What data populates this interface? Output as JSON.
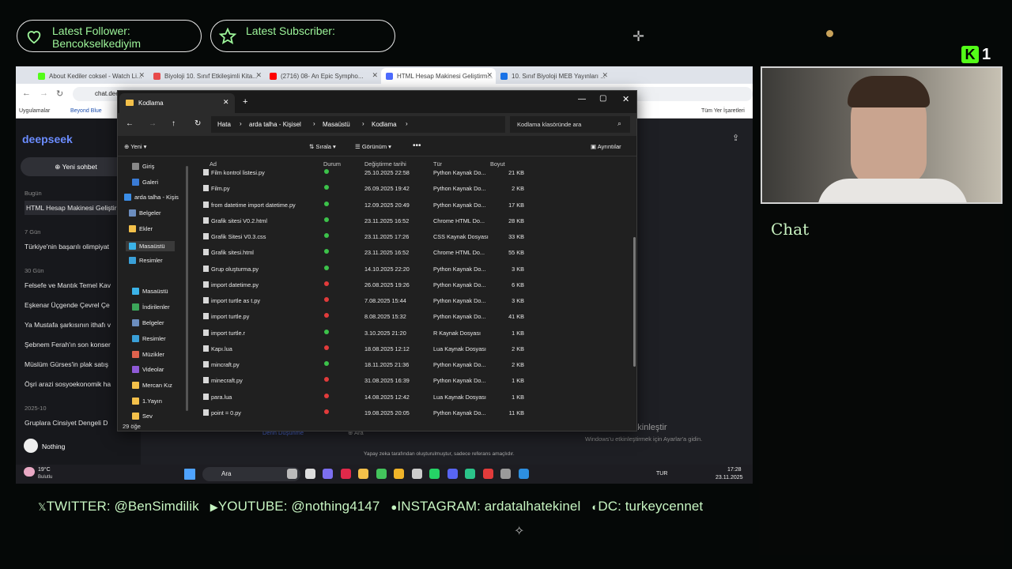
{
  "overlay": {
    "follower": {
      "label": "Latest Follower:",
      "name": "Bencokselkediyim"
    },
    "subscriber": {
      "label": "Latest Subscriber:"
    },
    "brand": "1",
    "chat_title": "Chat",
    "socials": [
      {
        "icon": "twitter-icon",
        "text": "TWITTER: @BenSimdilik"
      },
      {
        "icon": "youtube-icon",
        "text": "YOUTUBE: @nothing4147"
      },
      {
        "icon": "instagram-icon",
        "text": "INSTAGRAM: ardatalhatekinel"
      },
      {
        "icon": "discord-icon",
        "text": "DC: turkeycennet"
      }
    ]
  },
  "browser": {
    "tabs": [
      {
        "label": "About Kediler coksel - Watch Li...",
        "color": "#53fc18"
      },
      {
        "label": "Biyoloji 10. Sınıf Etkileşimli Kita...",
        "color": "#e94b4b"
      },
      {
        "label": "(2716) 08- An Epic Sympho...",
        "color": "#ff0000"
      },
      {
        "label": "HTML Hesap Makinesi Geliştirm...",
        "color": "#4d6bfe"
      },
      {
        "label": "10. Sınıf Biyoloji MEB Yayınları ...",
        "color": "#1a73e8"
      }
    ],
    "address": "chat.dee",
    "bookmarks": [
      "Uygulamalar",
      "Beyond Blue"
    ],
    "bookmarks_right": "Tüm Yer İşaretleri"
  },
  "deepseek": {
    "logo": "deepseek",
    "new_chat": "Yeni sohbet",
    "groups": [
      {
        "label": "Bugün",
        "items": [
          "HTML Hesap Makinesi Geliştir"
        ]
      },
      {
        "label": "7 Gün",
        "items": [
          "Türkiye'nin başarılı olimpiyat"
        ]
      },
      {
        "label": "30 Gün",
        "items": [
          "Felsefe ve Mantık Temel Kav",
          "Eşkenar Üçgende Çevrel Çe",
          "Ya Mustafa şarkısının ithafı v",
          "Şebnem Ferah'ın son konser",
          "Müslüm Gürses'in plak satış",
          "Öşri arazi sosyoekonomik ha"
        ]
      },
      {
        "label": "2025-10",
        "items": [
          "Gruplara Cinsiyet Dengeli D"
        ]
      }
    ],
    "user": "Nothing",
    "deep_think": "Derin Düşünme",
    "search": "Ara",
    "footer": "Yapay zeka tarafından oluşturulmuştur, sadece referans amaçlıdır."
  },
  "explorer": {
    "tab_title": "Kodlama",
    "breadcrumb": [
      "Hata",
      "arda talha - Kişisel",
      "Masaüstü",
      "Kodlama"
    ],
    "search_placeholder": "Kodlama klasöründe ara",
    "toolbar": {
      "new": "Yeni",
      "sort": "Sırala",
      "view": "Görünüm",
      "details": "Ayrıntılar"
    },
    "tree": [
      "Giriş",
      "Galeri",
      "arda talha - Kişis",
      "Belgeler",
      "Ekler",
      "Masaüstü",
      "Resimler",
      "Masaüstü",
      "İndirilenler",
      "Belgeler",
      "Resimler",
      "Müzikler",
      "Videolar",
      "Mercan Kız",
      "1.Yayın",
      "Sev"
    ],
    "columns": [
      "Ad",
      "Durum",
      "Değiştirme tarihi",
      "Tür",
      "Boyut"
    ],
    "files": [
      {
        "name": "Film kontrol listesi.py",
        "status": "ok",
        "date": "25.10.2025 22:58",
        "type": "Python Kaynak Do...",
        "size": "21 KB"
      },
      {
        "name": "Film.py",
        "status": "ok",
        "date": "26.09.2025 19:42",
        "type": "Python Kaynak Do...",
        "size": "2 KB"
      },
      {
        "name": "from datetime import datetime.py",
        "status": "ok",
        "date": "12.09.2025 20:49",
        "type": "Python Kaynak Do...",
        "size": "17 KB"
      },
      {
        "name": "Grafik sitesi V0.2.html",
        "status": "ok",
        "date": "23.11.2025 16:52",
        "type": "Chrome HTML Do...",
        "size": "28 KB"
      },
      {
        "name": "Grafik Sitesi V0.3.css",
        "status": "ok",
        "date": "23.11.2025 17:26",
        "type": "CSS Kaynak Dosyası",
        "size": "33 KB"
      },
      {
        "name": "Grafik sitesi.html",
        "status": "ok",
        "date": "23.11.2025 16:52",
        "type": "Chrome HTML Do...",
        "size": "55 KB"
      },
      {
        "name": "Grup oluşturma.py",
        "status": "ok",
        "date": "14.10.2025 22:20",
        "type": "Python Kaynak Do...",
        "size": "3 KB"
      },
      {
        "name": "import datetime.py",
        "status": "err",
        "date": "26.08.2025 19:26",
        "type": "Python Kaynak Do...",
        "size": "6 KB"
      },
      {
        "name": "import turtle as t.py",
        "status": "err",
        "date": "7.08.2025 15:44",
        "type": "Python Kaynak Do...",
        "size": "3 KB"
      },
      {
        "name": "import turtle.py",
        "status": "err",
        "date": "8.08.2025 15:32",
        "type": "Python Kaynak Do...",
        "size": "41 KB"
      },
      {
        "name": "import turtle.r",
        "status": "ok",
        "date": "3.10.2025 21:20",
        "type": "R Kaynak Dosyası",
        "size": "1 KB"
      },
      {
        "name": "Kapı.lua",
        "status": "err",
        "date": "18.08.2025 12:12",
        "type": "Lua Kaynak Dosyası",
        "size": "2 KB"
      },
      {
        "name": "mincraft.py",
        "status": "ok",
        "date": "18.11.2025 21:36",
        "type": "Python Kaynak Do...",
        "size": "2 KB"
      },
      {
        "name": "minecraft.py",
        "status": "err",
        "date": "31.08.2025 16:39",
        "type": "Python Kaynak Do...",
        "size": "1 KB"
      },
      {
        "name": "para.lua",
        "status": "err",
        "date": "14.08.2025 12:42",
        "type": "Lua Kaynak Dosyası",
        "size": "1 KB"
      },
      {
        "name": "point = 0.py",
        "status": "err",
        "date": "19.08.2025 20:05",
        "type": "Python Kaynak Do...",
        "size": "11 KB"
      }
    ],
    "item_count": "29 öğe",
    "status_colors": {
      "ok": "#3cc24a",
      "err": "#e23b3b"
    }
  },
  "windows": {
    "activate_title": "Windows'u Etkinleştir",
    "activate_sub": "Windows'u etkinleştirmek için Ayarlar'a gidin.",
    "weather_temp": "19°C",
    "weather_desc": "Bulutlu",
    "search": "Ara",
    "lang": "TUR",
    "time": "17:28",
    "date": "23.11.2025"
  }
}
